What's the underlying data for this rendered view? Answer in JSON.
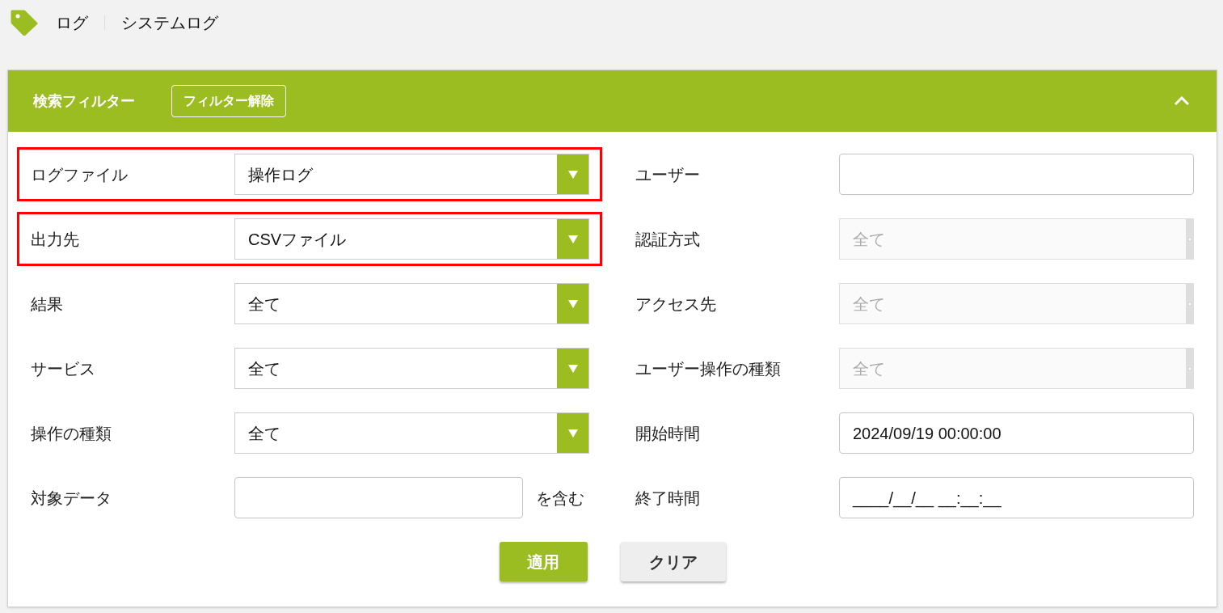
{
  "breadcrumb": [
    {
      "label": "ログ"
    },
    {
      "label": "システムログ"
    }
  ],
  "filter_panel": {
    "title": "検索フィルター",
    "clear_filter_button": "フィルター解除",
    "expanded": true,
    "left_fields": [
      {
        "label": "ログファイル",
        "kind": "select",
        "value": "操作ログ",
        "disabled": false,
        "highlighted": true
      },
      {
        "label": "出力先",
        "kind": "select",
        "value": "CSVファイル",
        "disabled": false,
        "highlighted": true
      },
      {
        "label": "結果",
        "kind": "select",
        "value": "全て",
        "disabled": false,
        "highlighted": false
      },
      {
        "label": "サービス",
        "kind": "select",
        "value": "全て",
        "disabled": false,
        "highlighted": false
      },
      {
        "label": "操作の種類",
        "kind": "select",
        "value": "全て",
        "disabled": false,
        "highlighted": false
      },
      {
        "label": "対象データ",
        "kind": "text",
        "suffix": "を含む",
        "highlighted": false
      }
    ],
    "right_fields": [
      {
        "label": "ユーザー",
        "kind": "text"
      },
      {
        "label": "認証方式",
        "kind": "select",
        "value": "全て",
        "disabled": true
      },
      {
        "label": "アクセス先",
        "kind": "select",
        "value": "全て",
        "disabled": true
      },
      {
        "label": "ユーザー操作の種類",
        "kind": "select",
        "value": "全て",
        "disabled": true
      },
      {
        "label": "開始時間",
        "kind": "text",
        "value": "2024/09/19 00:00:00"
      },
      {
        "label": "終了時間",
        "kind": "text",
        "value": "____/__/__ __:__:__"
      }
    ],
    "buttons": [
      {
        "label": "適用",
        "kind": "primary"
      },
      {
        "label": "クリア",
        "kind": "secondary"
      }
    ]
  }
}
